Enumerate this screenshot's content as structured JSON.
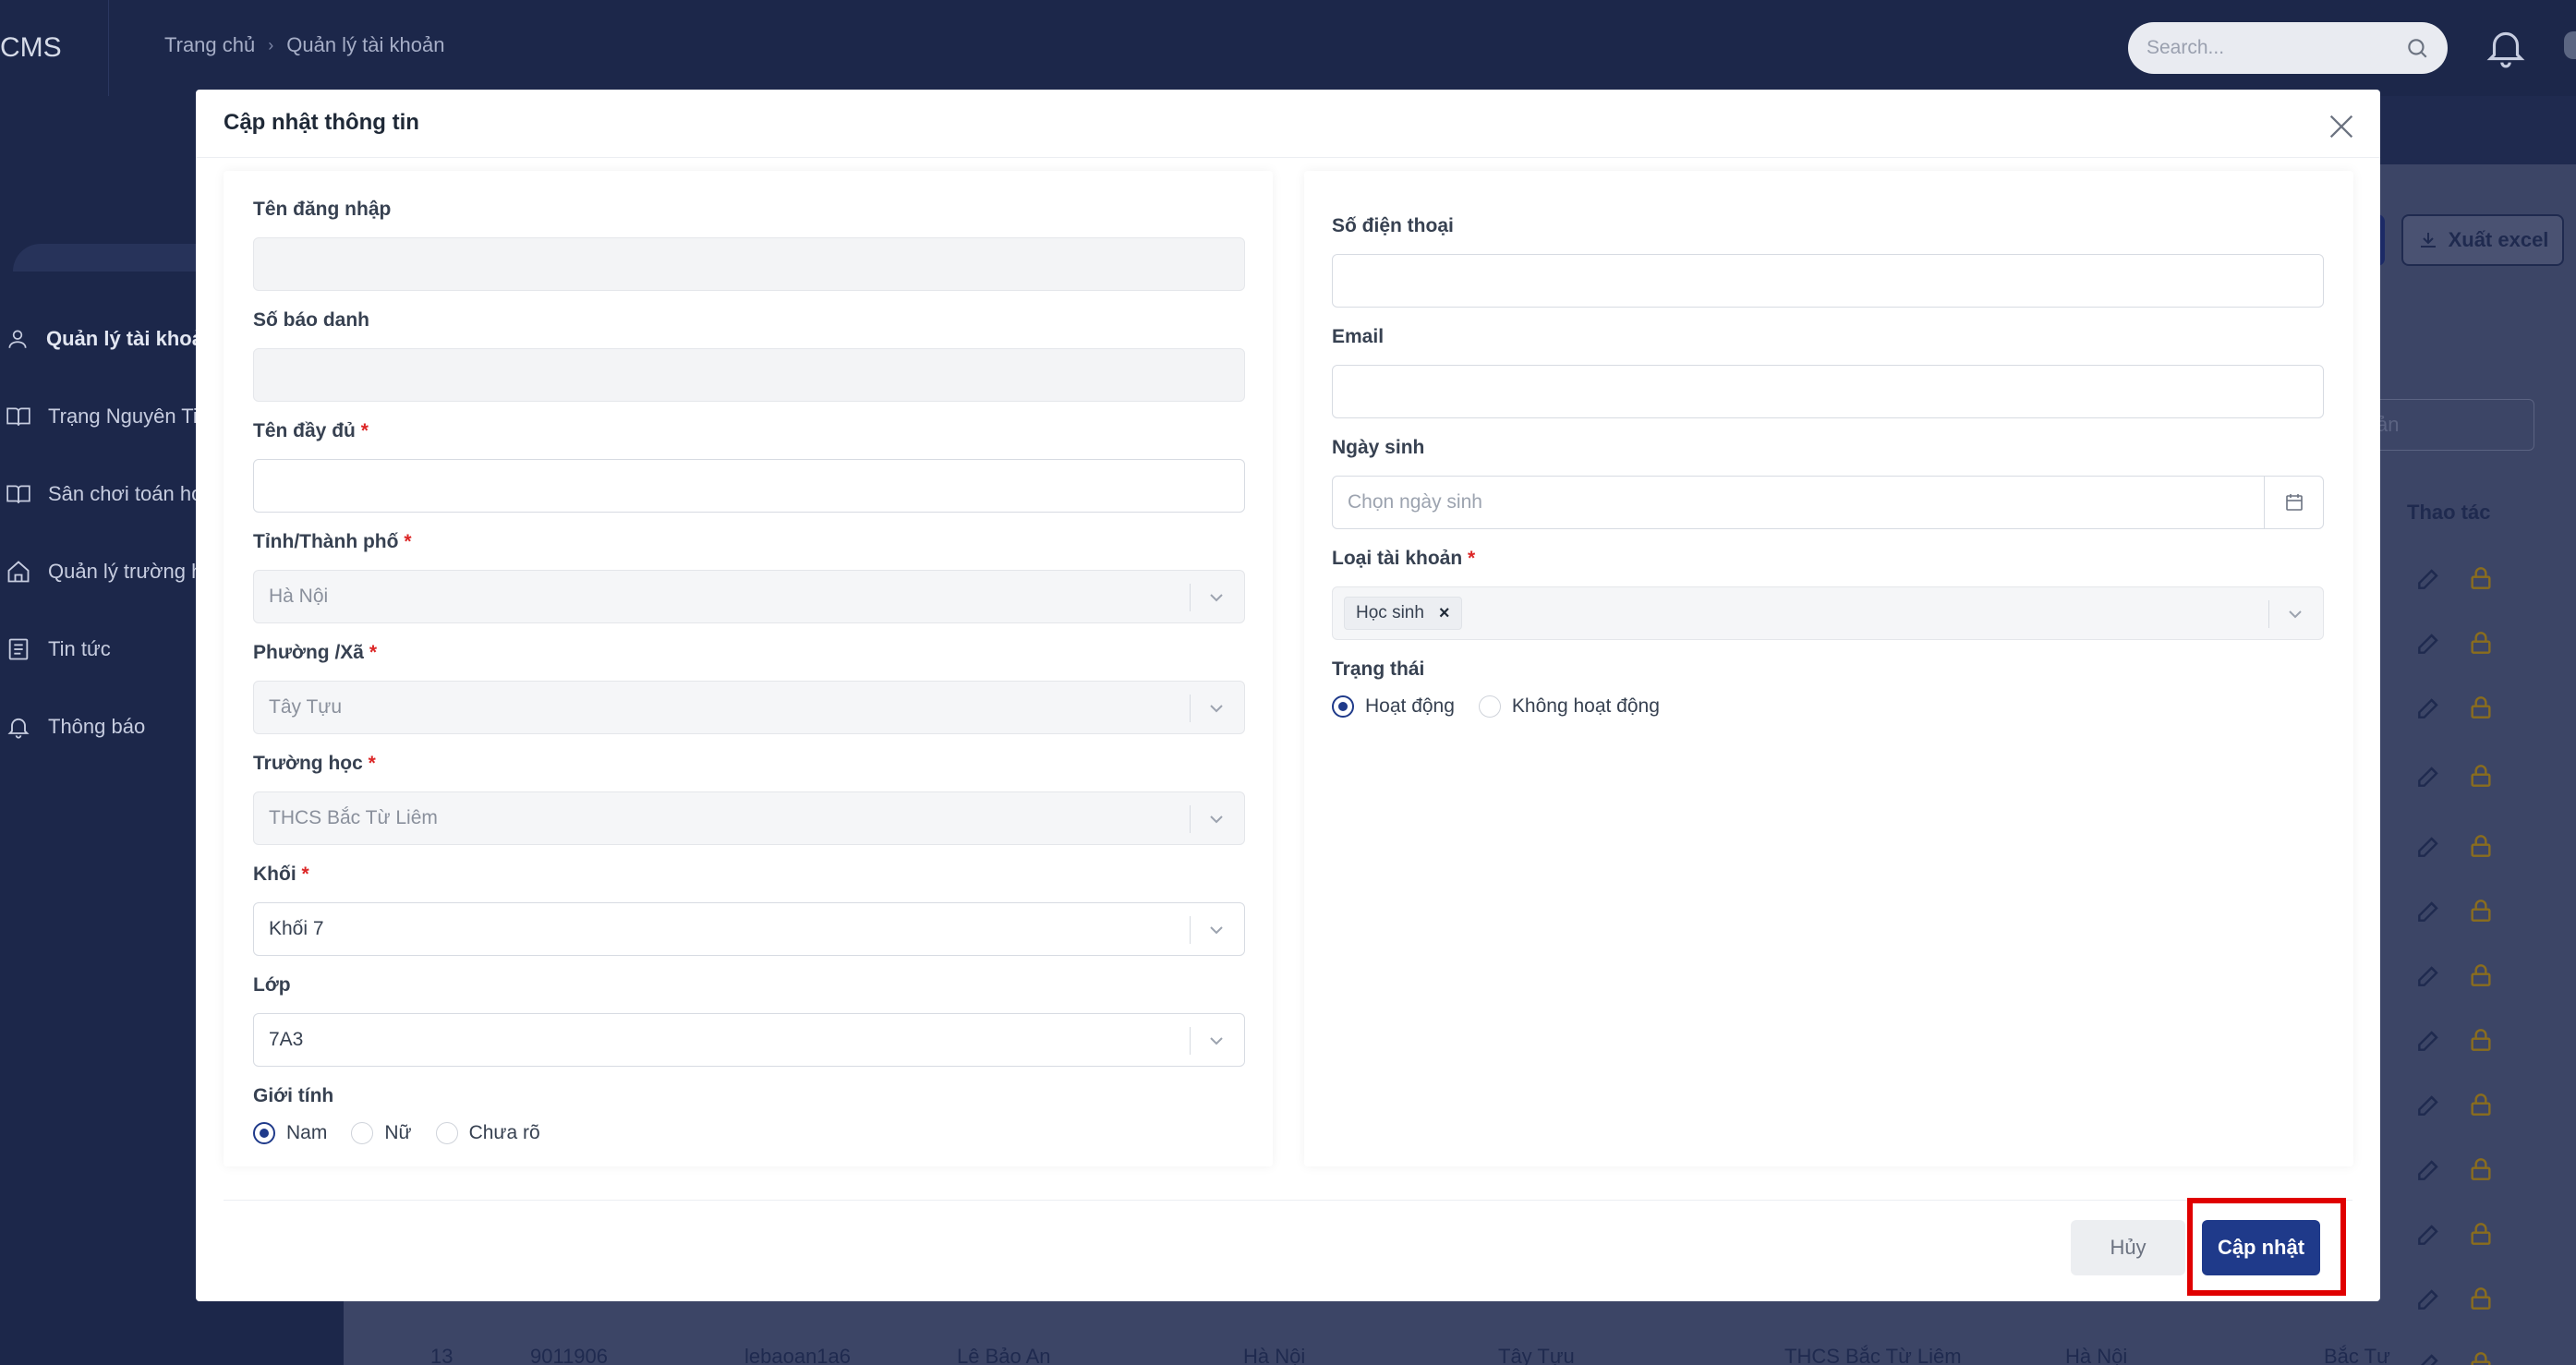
{
  "app": {
    "logo_text": "CMS",
    "breadcrumb": [
      "Trang chủ",
      "Quản lý tài khoản"
    ],
    "search_placeholder": "Search..."
  },
  "sidebar": {
    "items": [
      {
        "label": "Quản lý tài khoản",
        "icon": "user-icon",
        "active": true
      },
      {
        "label": "Trạng Nguyên Tiếng Việt",
        "icon": "book-icon"
      },
      {
        "label": "Sân chơi toán học",
        "icon": "book-open-icon"
      },
      {
        "label": "Quản lý trường học",
        "icon": "home-icon"
      },
      {
        "label": "Tin tức",
        "icon": "news-icon"
      },
      {
        "label": "Thông báo",
        "icon": "bell-icon"
      }
    ]
  },
  "background_page": {
    "export_label": "Xuất excel",
    "filter_peek": "ản",
    "actions_header": "Thao tác",
    "last_row": {
      "stt": "13",
      "sbd": "9011906",
      "username": "lebaoan1a6",
      "name": "Lê Bảo An",
      "city": "Hà Nội",
      "ward": "Tây Tựu",
      "school": "THCS Bắc Từ Liêm",
      "city2": "Hà Nội",
      "more": "Bắc Tư"
    }
  },
  "modal": {
    "title": "Cập nhật thông tin",
    "left": {
      "username_label": "Tên đăng nhập",
      "username_value": "",
      "sbd_label": "Số báo danh",
      "sbd_value": "",
      "fullname_label": "Tên đầy đủ",
      "fullname_value": "",
      "province_label": "Tỉnh/Thành phố",
      "province_value": "Hà Nội",
      "ward_label": "Phường /Xã",
      "ward_value": "Tây Tựu",
      "school_label": "Trường học",
      "school_value": "THCS Bắc Từ Liêm",
      "grade_label": "Khối",
      "grade_value": "Khối 7",
      "class_label": "Lớp",
      "class_value": "7A3",
      "gender_label": "Giới tính",
      "gender_options": [
        "Nam",
        "Nữ",
        "Chưa rõ"
      ],
      "gender_selected": "Nam"
    },
    "right": {
      "phone_label": "Số điện thoại",
      "phone_value": "",
      "email_label": "Email",
      "email_value": "",
      "dob_label": "Ngày sinh",
      "dob_placeholder": "Chọn ngày sinh",
      "account_type_label": "Loại tài khoản",
      "account_type_tag": "Học sinh",
      "status_label": "Trạng thái",
      "status_options": [
        "Hoạt động",
        "Không hoạt động"
      ],
      "status_selected": "Hoạt động"
    },
    "cancel_label": "Hủy",
    "submit_label": "Cập nhật"
  },
  "colors": {
    "primary": "#1f3a8a",
    "required": "#dc2626",
    "highlight": "#e00000",
    "sidebar_bg": "#1c274a"
  }
}
